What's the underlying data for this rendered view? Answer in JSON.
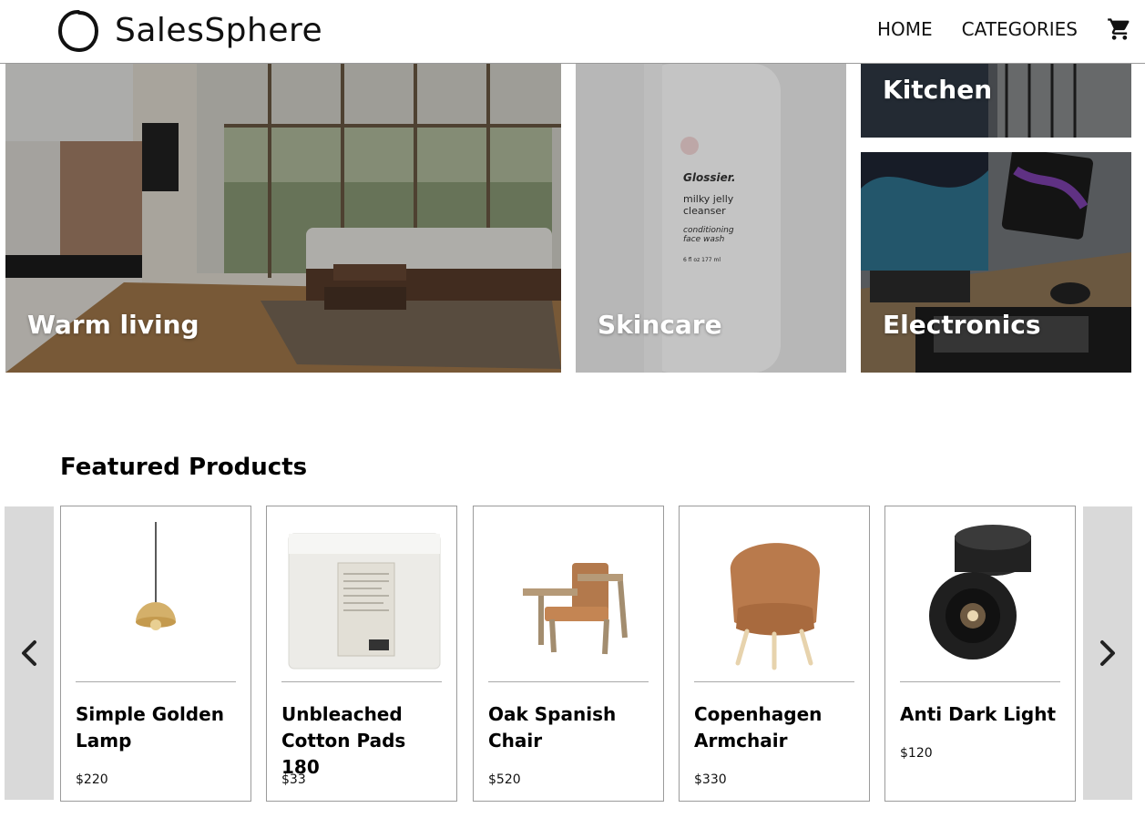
{
  "brand": {
    "name": "SalesSphere"
  },
  "nav": {
    "home": "HOME",
    "categories": "CATEGORIES",
    "cart_icon": "cart-icon"
  },
  "hero": {
    "tiles": [
      {
        "label": "Warm living"
      },
      {
        "label": "Skincare",
        "product_text": [
          "Glossier.",
          "milky jelly",
          "cleanser",
          "conditioning",
          "face wash",
          "6 fl oz   177 ml"
        ]
      },
      {
        "label": "Kitchen"
      },
      {
        "label": "Electronics"
      }
    ]
  },
  "featured": {
    "title": "Featured Products",
    "prev_icon": "chevron-left-icon",
    "next_icon": "chevron-right-icon",
    "products": [
      {
        "name": "Simple Golden Lamp",
        "price": "$220",
        "icon": "pendant-lamp-image"
      },
      {
        "name": "Unbleached Cotton Pads 180",
        "price": "$33",
        "icon": "cotton-pads-image"
      },
      {
        "name": "Oak Spanish Chair",
        "price": "$520",
        "icon": "spanish-chair-image"
      },
      {
        "name": "Copenhagen Armchair",
        "price": "$330",
        "icon": "armchair-image"
      },
      {
        "name": "Anti Dark Light",
        "price": "$120",
        "icon": "spotlight-image"
      }
    ]
  },
  "colors": {
    "overlay": "#000000",
    "arrow_bg": "#d9d9d9",
    "card_border": "#9b9b9b"
  }
}
